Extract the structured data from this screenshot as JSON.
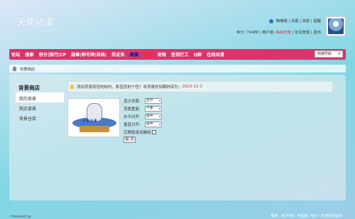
{
  "site": {
    "logo_text": "天使动漫"
  },
  "topbar": {
    "username": "楠楠喵",
    "links": [
      "设置",
      "消息",
      "提醒"
    ],
    "points_label": "积分: 74488",
    "user_group_label": "用户组:",
    "user_group": "高级天使",
    "admin_link": "论坛管理",
    "logout": "退出"
  },
  "nav": {
    "items": [
      "论坛",
      "搜索",
      "积分|银行|CP",
      "勋章|称号牌|风格|",
      "防走失",
      "藏藏",
      "抽奖",
      "宠物",
      "签到打工",
      "Q群",
      "在线动漫"
    ],
    "quick_nav": "快捷导航"
  },
  "breadcrumb": {
    "current": "背景商店"
  },
  "sidebar": {
    "title": "背景商店",
    "items": [
      "我的背景",
      "购买背景",
      "背景仓库"
    ]
  },
  "notice": {
    "text": "添加背景到您的帖内，彰显您的个性！本背景的到期时间为：",
    "date": "2023-12-1"
  },
  "preview": {
    "caption": "天 使 动 漫"
  },
  "form": {
    "display_label": "显示背景:",
    "display_value": "显示",
    "repeat_label": "背景重复:",
    "repeat_value": "不重",
    "halign_label": "水平对齐:",
    "halign_value": "居中",
    "valign_label": "垂直对齐:",
    "valign_value": "居中",
    "test_label": "完屏版测试确用",
    "submit": "提 交"
  },
  "footer": {
    "left": "Powered by",
    "right": "联系 · ACFUN · 手机版 · Kkk · 天使动漫论坛"
  }
}
